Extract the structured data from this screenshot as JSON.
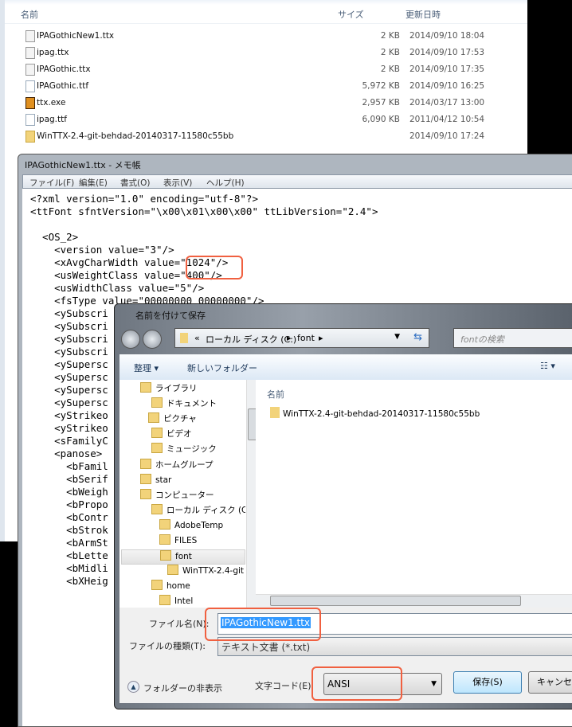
{
  "explorer": {
    "columns": {
      "name": "名前",
      "size": "サイズ",
      "modified": "更新日時"
    },
    "files": [
      {
        "name": "IPAGothicNew1.ttx",
        "size": "2 KB",
        "modified": "2014/09/10 18:04",
        "icon": "text-file-icon"
      },
      {
        "name": "ipag.ttx",
        "size": "2 KB",
        "modified": "2014/09/10 17:53",
        "icon": "text-file-icon"
      },
      {
        "name": "IPAGothic.ttx",
        "size": "2 KB",
        "modified": "2014/09/10 17:35",
        "icon": "text-file-icon"
      },
      {
        "name": "IPAGothic.ttf",
        "size": "5,972 KB",
        "modified": "2014/09/10 16:25",
        "icon": "font-file-icon"
      },
      {
        "name": "ttx.exe",
        "size": "2,957 KB",
        "modified": "2014/03/17 13:00",
        "icon": "exe-icon"
      },
      {
        "name": "ipag.ttf",
        "size": "6,090 KB",
        "modified": "2011/04/12 10:54",
        "icon": "font-file-icon"
      },
      {
        "name": "WinTTX-2.4-git-behdad-20140317-11580c55bb",
        "size": "",
        "modified": "2014/09/10 17:24",
        "icon": "folder-icon"
      }
    ]
  },
  "notepad": {
    "title": "IPAGothicNew1.ttx - メモ帳",
    "menu": [
      "ファイル(F)",
      "編集(E)",
      "書式(O)",
      "表示(V)",
      "ヘルプ(H)"
    ],
    "lines": [
      "<?xml version=\"1.0\" encoding=\"utf-8\"?>",
      "<ttFont sfntVersion=\"\\x00\\x01\\x00\\x00\" ttLibVersion=\"2.4\">",
      "",
      "  <OS_2>",
      "    <version value=\"3\"/>",
      "    <xAvgCharWidth value=\"1024\"/>",
      "    <usWeightClass value=\"400\"/>",
      "    <usWidthClass value=\"5\"/>",
      "    <fsType value=\"00000000 00000000\"/>",
      "    <ySubscri",
      "    <ySubscri",
      "    <ySubscri",
      "    <ySubscri",
      "    <ySupersc",
      "    <ySupersc",
      "    <ySupersc",
      "    <ySupersc",
      "    <yStrikeo",
      "    <yStrikeo",
      "    <sFamilyC",
      "    <panose>",
      "      <bFamil",
      "      <bSerif",
      "      <bWeigh",
      "      <bPropo",
      "      <bContr",
      "      <bStrok",
      "      <bArmSt",
      "      <bLette",
      "      <bMidli",
      "      <bXHeig"
    ]
  },
  "dialog": {
    "title": "名前を付けて保存",
    "address": [
      "«",
      "ローカル ディスク (C:)",
      "▸",
      "font",
      "▸"
    ],
    "search_placeholder": "fontの検索",
    "toolbar": {
      "organize": "整理 ▾",
      "new_folder": "新しいフォルダー"
    },
    "nav": [
      "ライブラリ",
      "ドキュメント",
      "ピクチャ",
      "ビデオ",
      "ミュージック",
      "ホームグループ",
      "star",
      "コンピューター",
      "ローカル ディスク (C",
      "AdobeTemp",
      "FILES",
      "font",
      "WinTTX-2.4-git",
      "home",
      "Intel"
    ],
    "list_header": "名前",
    "list_items": [
      "WinTTX-2.4-git-behdad-20140317-11580c55bb"
    ],
    "filename_label": "ファイル名(N):",
    "filename_value": "IPAGothicNew1.ttx",
    "filetype_label": "ファイルの種類(T):",
    "filetype_value": "テキスト文書 (*.txt)",
    "encoding_label": "文字コード(E):",
    "encoding_value": "ANSI",
    "hide_folders": "フォルダーの非表示",
    "save": "保存(S)",
    "cancel": "キャンセル"
  },
  "colors": {
    "annotation": "#f06040",
    "selection": "#3399ff"
  }
}
